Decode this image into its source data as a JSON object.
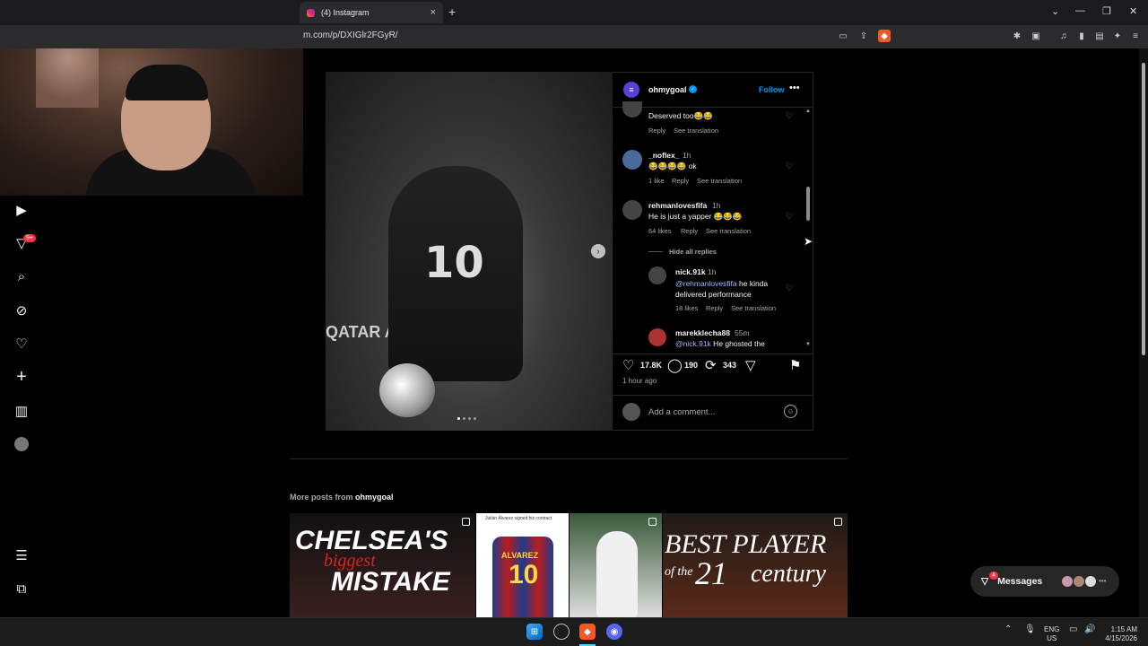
{
  "browser": {
    "tab_title": "(4) Instagram",
    "tab_close": "×",
    "new_tab": "+",
    "url": "m.com/p/DXIGlr2FGyR/",
    "window_controls": {
      "dropdown": "⌄",
      "minimize": "—",
      "restore": "❐",
      "close": "✕"
    }
  },
  "nav": {
    "notification_badge": "9+",
    "icons": [
      "reels-icon",
      "notifications-icon",
      "search-icon",
      "explore-icon",
      "heart-icon",
      "create-icon",
      "insights-icon",
      "profile-icon",
      "menu-icon",
      "apps-icon"
    ]
  },
  "post": {
    "account": "ohmygoal",
    "follow": "Follow",
    "more": "•••",
    "image": {
      "jersey_number": "10",
      "banner_text": "QATAR A"
    },
    "comments": [
      {
        "user": "",
        "time": "",
        "text": "Deserved too😂😂",
        "likes": "",
        "reply": "Reply",
        "translate": "See translation"
      },
      {
        "user": "_noflex_",
        "time": "1h",
        "text": "😂😂😂😂 ok",
        "likes": "1 like",
        "reply": "Reply",
        "translate": "See translation"
      },
      {
        "user": "rehmanlovesfifa",
        "time": "1h",
        "text": "He is just a yapper 😂😂😂",
        "likes": "64 likes",
        "reply": "Reply",
        "translate": "See translation"
      }
    ],
    "hide_replies": "Hide all replies",
    "replies": [
      {
        "user": "nick.91k",
        "time": "1h",
        "mention": "@rehmanlovesfifa",
        "text": " he kinda delivered performance",
        "likes": "18 likes",
        "reply": "Reply",
        "translate": "See translation"
      },
      {
        "user": "marekklecha88",
        "time": "55m",
        "mention": "@nick.91k",
        "text": " He ghosted the"
      }
    ],
    "likes": "17.8K",
    "comments_count": "190",
    "reposts": "343",
    "time_ago": "1 hour ago",
    "add_comment_placeholder": "Add a comment..."
  },
  "more_posts": {
    "label": "More posts from",
    "account": "ohmygoal",
    "thumbs": [
      {
        "line1": "CHELSEA'S",
        "line2": "biggest",
        "line3": "MISTAKE"
      },
      {
        "caption": "Julián Álvarez signed his contract",
        "shirt_name": "ALVAREZ",
        "shirt_number": "10"
      },
      {},
      {
        "line1": "BEST PLAYER",
        "line2": "of the",
        "line3": "21",
        "line4": "century"
      }
    ]
  },
  "messages": {
    "label": "Messages",
    "badge": "4"
  },
  "taskbar": {
    "lang": "ENG",
    "region": "US",
    "time": "1:15 AM",
    "date": "4/15/2026"
  }
}
